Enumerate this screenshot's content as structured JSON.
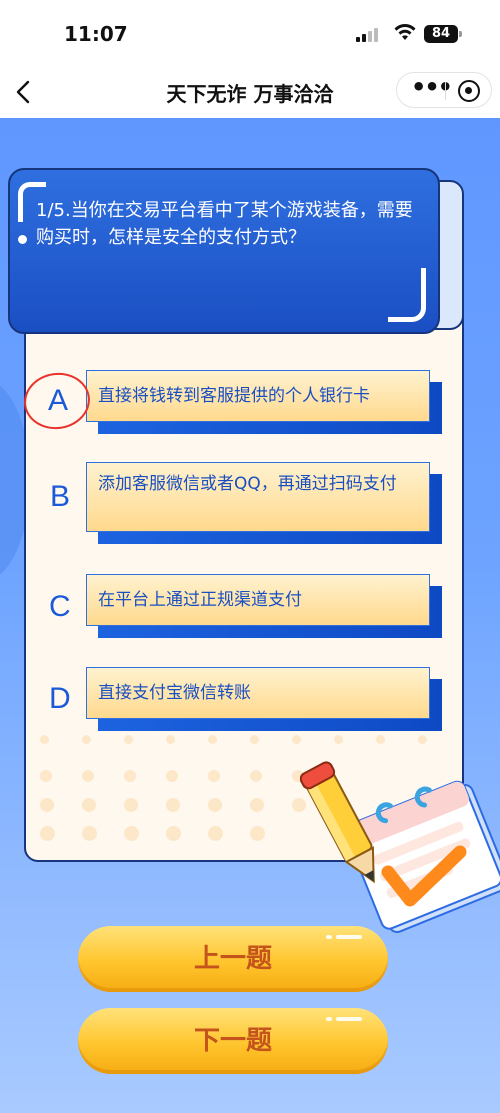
{
  "status_bar": {
    "time": "11:07",
    "battery": "84"
  },
  "nav": {
    "title": "天下无诈 万事洽洽"
  },
  "question": {
    "text": "1/5.当你在交易平台看中了某个游戏装备，需要购买时，怎样是安全的支付方式？"
  },
  "options": [
    {
      "letter": "A",
      "text": "直接将钱转到客服提供的个人银行卡",
      "circled": true
    },
    {
      "letter": "B",
      "text": "添加客服微信或者QQ，再通过扫码支付",
      "circled": false
    },
    {
      "letter": "C",
      "text": "在平台上通过正规渠道支付",
      "circled": false
    },
    {
      "letter": "D",
      "text": "直接支付宝微信转账",
      "circled": false
    }
  ],
  "buttons": {
    "prev": "上一题",
    "next": "下一题"
  },
  "colors": {
    "accent_blue": "#1a5ad8",
    "option_fill": "#ffd98d",
    "button_yellow": "#ffc52d",
    "mark_red": "#e8322a"
  }
}
